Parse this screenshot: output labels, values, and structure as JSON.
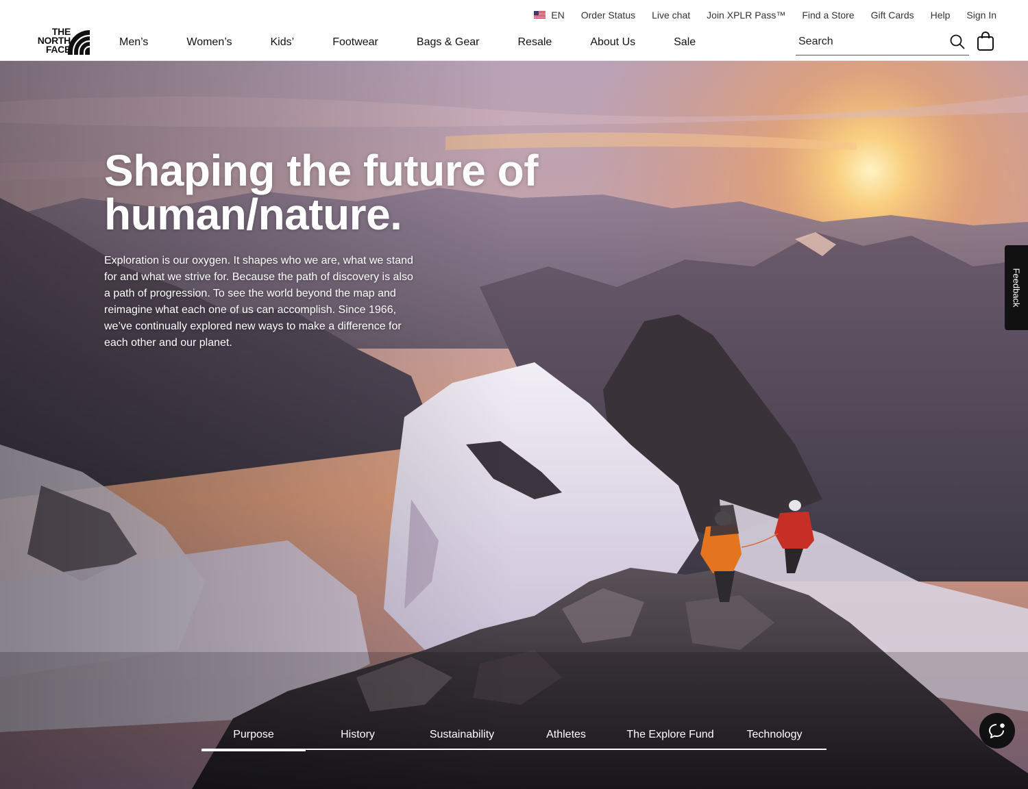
{
  "utility_nav": {
    "language": "EN",
    "items": [
      "Order Status",
      "Live chat",
      "Join XPLR Pass™",
      "Find a Store",
      "Gift Cards",
      "Help",
      "Sign In"
    ]
  },
  "brand": {
    "logo_lines": [
      "THE",
      "NORTH",
      "FACE"
    ]
  },
  "main_nav": [
    "Men’s",
    "Women’s",
    "Kids’",
    "Footwear",
    "Bags & Gear",
    "Resale",
    "About Us",
    "Sale"
  ],
  "search": {
    "placeholder": "Search",
    "value": ""
  },
  "hero": {
    "title_lines": [
      "Shaping the future of",
      "human/nature."
    ],
    "body": "Exploration is our oxygen. It shapes who we are, what we stand for and what we strive for. Because the path of discovery is also a path of progression. To see the world beyond the map and reimagine what each one of us can accomplish. Since 1966, we’ve continually explored new ways to make a difference for each other and our planet."
  },
  "feedback_label": "Feedback",
  "sub_nav": {
    "items": [
      "Purpose",
      "History",
      "Sustainability",
      "Athletes",
      "The Explore Fund",
      "Technology"
    ],
    "active": "Purpose"
  },
  "icons": {
    "flag": "us-flag-icon",
    "search": "search-icon",
    "cart": "shopping-bag-icon",
    "chat": "chat-bubble-icon"
  }
}
